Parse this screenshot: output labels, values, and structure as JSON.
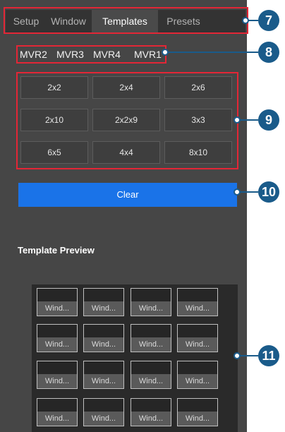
{
  "tabs": [
    {
      "label": "Setup",
      "active": false
    },
    {
      "label": "Window",
      "active": false
    },
    {
      "label": "Templates",
      "active": true
    },
    {
      "label": "Presets",
      "active": false
    }
  ],
  "mvr_tabs": [
    "MVR2",
    "MVR3",
    "MVR4",
    "MVR1"
  ],
  "templates": [
    [
      "2x2",
      "2x4",
      "2x6"
    ],
    [
      "2x10",
      "2x2x9",
      "3x3"
    ],
    [
      "6x5",
      "4x4",
      "8x10"
    ]
  ],
  "clear_label": "Clear",
  "preview": {
    "title": "Template Preview",
    "cell_label": "Wind...",
    "rows": 4,
    "cols": 4
  },
  "callouts": [
    "7",
    "8",
    "9",
    "10",
    "11"
  ],
  "colors": {
    "panel": "#464646",
    "accent": "#1a73e8",
    "callout_border": "#e32636",
    "badge": "#1a5b8a"
  }
}
